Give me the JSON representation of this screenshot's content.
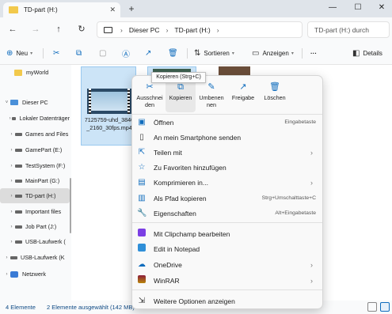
{
  "window": {
    "tab_title": "TD-part (H:)",
    "close_tab": "✕",
    "new_tab": "+",
    "minimize": "—",
    "maximize": "☐",
    "close": "✕"
  },
  "address": {
    "back": "←",
    "forward": "→",
    "up": "↑",
    "refresh": "↻",
    "crumbs": [
      "Dieser PC",
      "TD-part (H:)"
    ],
    "search_placeholder": "TD-part (H:) durch"
  },
  "toolbar": {
    "new_label": "Neu",
    "sort_label": "Sortieren",
    "view_label": "Anzeigen",
    "more_label": "···",
    "details_label": "Details"
  },
  "sidebar": {
    "items": [
      {
        "label": "myWorld"
      },
      {
        "label": "Dieser PC"
      },
      {
        "label": "Lokaler Datenträger"
      },
      {
        "label": "Games and Files"
      },
      {
        "label": "GamePart (E:)"
      },
      {
        "label": "TestSystem (F:)"
      },
      {
        "label": "MainPart (G:)"
      },
      {
        "label": "TD-part (H:)"
      },
      {
        "label": "Important files"
      },
      {
        "label": "Job Part (J:)"
      },
      {
        "label": "USB-Laufwerk ("
      },
      {
        "label": "USB-Laufwerk (K"
      },
      {
        "label": "Netzwerk"
      }
    ]
  },
  "files": [
    {
      "name": "7125759-uhd_3840_2160_30fps.mp4"
    }
  ],
  "status": {
    "count": "4 Elemente",
    "selected": "2 Elemente ausgewählt (142 MB)"
  },
  "context_menu": {
    "tooltip": "Kopieren (Strg+C)",
    "quick_actions": [
      {
        "icon": "✂",
        "label": "Ausschneiden"
      },
      {
        "icon": "⧉",
        "label": "Kopieren"
      },
      {
        "icon": "✎",
        "label": "Umbenennen"
      },
      {
        "icon": "↗",
        "label": "Freigabe"
      },
      {
        "icon": "🗑",
        "label": "Löschen"
      }
    ],
    "items": [
      {
        "label": "Öffnen",
        "shortcut": "Eingabetaste"
      },
      {
        "label": "An mein Smartphone senden",
        "shortcut": ""
      },
      {
        "label": "Teilen mit",
        "shortcut": ""
      },
      {
        "label": "Zu Favoriten hinzufügen",
        "shortcut": ""
      },
      {
        "label": "Komprimieren in...",
        "shortcut": ""
      },
      {
        "label": "Als Pfad kopieren",
        "shortcut": "Strg+Umschalttaste+C"
      },
      {
        "label": "Eigenschaften",
        "shortcut": "Alt+Eingabetaste"
      },
      {
        "label": "Mit Clipchamp bearbeiten",
        "shortcut": ""
      },
      {
        "label": "Edit in Notepad",
        "shortcut": ""
      },
      {
        "label": "OneDrive",
        "shortcut": ""
      },
      {
        "label": "WinRAR",
        "shortcut": ""
      },
      {
        "label": "Weitere Optionen anzeigen",
        "shortcut": ""
      }
    ]
  },
  "colors": {
    "accent": "#0f6cbd",
    "selection": "#cce4f7",
    "folder": "#f2c94c"
  }
}
